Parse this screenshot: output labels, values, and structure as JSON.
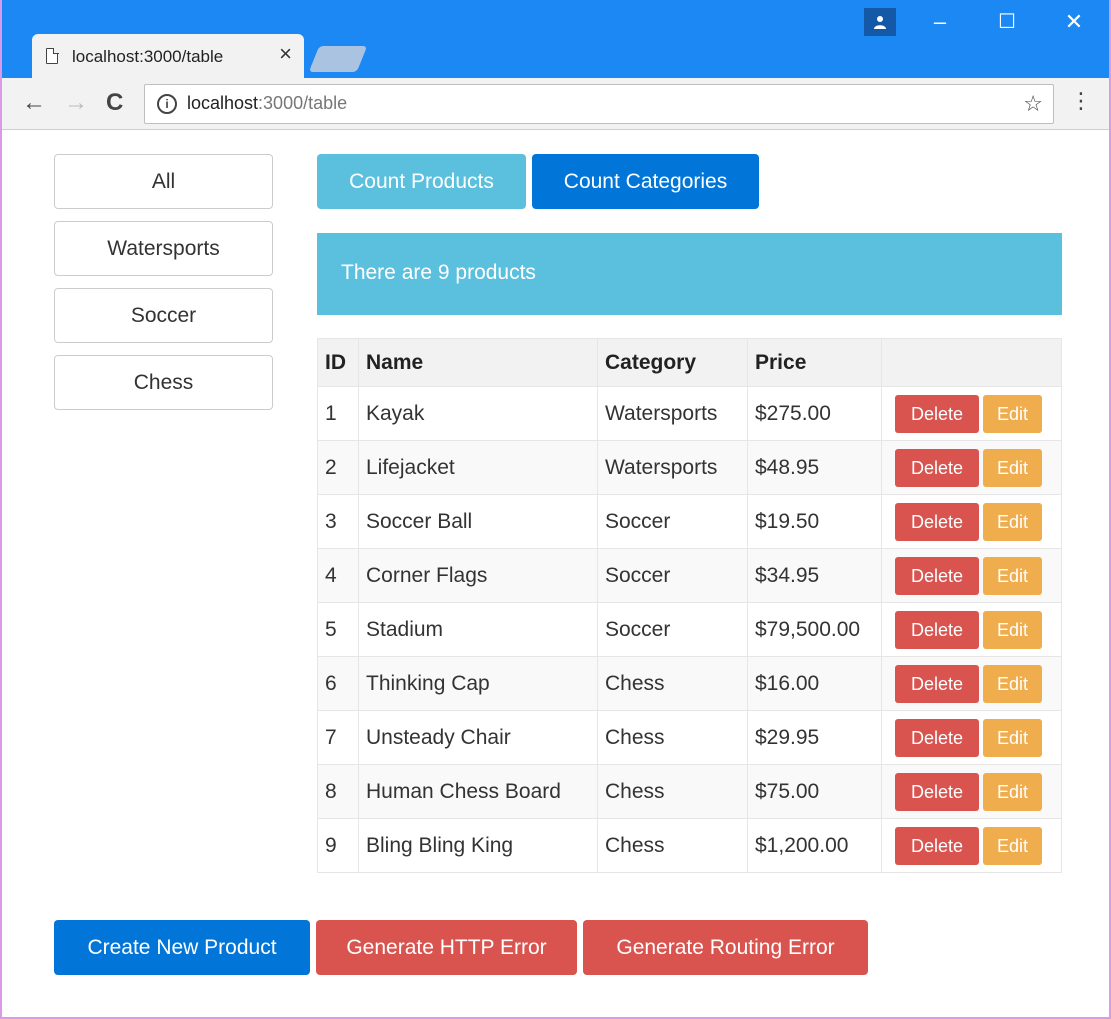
{
  "browser": {
    "tab_title": "localhost:3000/table",
    "tab_close": "×",
    "url_host": "localhost",
    "url_rest": ":3000/table",
    "minimize": "–",
    "maximize": "☐",
    "close": "✕"
  },
  "sidebar": {
    "items": [
      {
        "label": "All"
      },
      {
        "label": "Watersports"
      },
      {
        "label": "Soccer"
      },
      {
        "label": "Chess"
      }
    ]
  },
  "actions": {
    "count_products": "Count Products",
    "count_categories": "Count Categories"
  },
  "message": "There are 9 products",
  "table": {
    "headers": [
      "ID",
      "Name",
      "Category",
      "Price"
    ],
    "delete_label": "Delete",
    "edit_label": "Edit",
    "rows": [
      {
        "id": "1",
        "name": "Kayak",
        "category": "Watersports",
        "price": "$275.00"
      },
      {
        "id": "2",
        "name": "Lifejacket",
        "category": "Watersports",
        "price": "$48.95"
      },
      {
        "id": "3",
        "name": "Soccer Ball",
        "category": "Soccer",
        "price": "$19.50"
      },
      {
        "id": "4",
        "name": "Corner Flags",
        "category": "Soccer",
        "price": "$34.95"
      },
      {
        "id": "5",
        "name": "Stadium",
        "category": "Soccer",
        "price": "$79,500.00"
      },
      {
        "id": "6",
        "name": "Thinking Cap",
        "category": "Chess",
        "price": "$16.00"
      },
      {
        "id": "7",
        "name": "Unsteady Chair",
        "category": "Chess",
        "price": "$29.95"
      },
      {
        "id": "8",
        "name": "Human Chess Board",
        "category": "Chess",
        "price": "$75.00"
      },
      {
        "id": "9",
        "name": "Bling Bling King",
        "category": "Chess",
        "price": "$1,200.00"
      }
    ]
  },
  "footer": {
    "create": "Create New Product",
    "http_error": "Generate HTTP Error",
    "routing_error": "Generate Routing Error"
  },
  "colors": {
    "primary": "#0275d8",
    "info": "#5bc0de",
    "danger": "#d9534f",
    "warning": "#f0ad4e",
    "titlebar": "#1b88f4"
  }
}
